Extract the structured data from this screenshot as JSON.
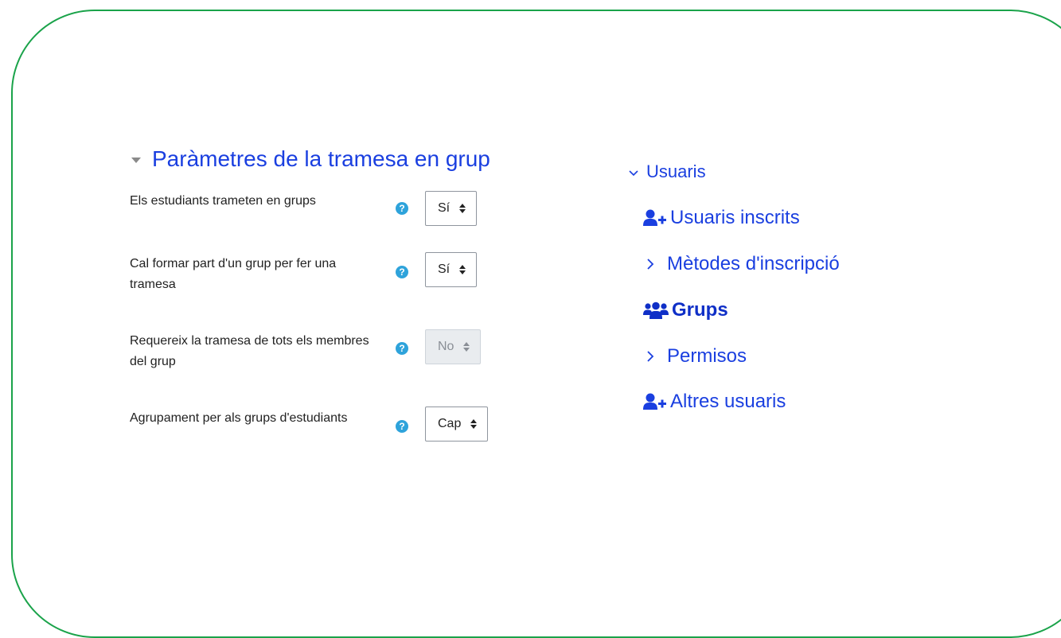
{
  "form": {
    "section_title": "Paràmetres de la tramesa en grup",
    "rows": [
      {
        "label": "Els estudiants trameten en grups",
        "value": "Sí",
        "disabled": false
      },
      {
        "label": "Cal formar part d'un grup per fer una tramesa",
        "value": "Sí",
        "disabled": false
      },
      {
        "label": "Requereix la tramesa de tots els membres del grup",
        "value": "No",
        "disabled": true
      },
      {
        "label": "Agrupament per als grups d'estudiants",
        "value": "Cap",
        "disabled": false
      }
    ],
    "help_glyph": "?"
  },
  "nav": {
    "root": "Usuaris",
    "items": [
      {
        "label": "Usuaris inscrits",
        "icon": "user-plus-icon"
      },
      {
        "label": "Mètodes d'inscripció",
        "icon": "chevron-right-icon"
      },
      {
        "label": "Grups",
        "icon": "users-icon",
        "active": true
      },
      {
        "label": "Permisos",
        "icon": "chevron-right-icon"
      },
      {
        "label": "Altres usuaris",
        "icon": "user-plus-icon"
      }
    ]
  },
  "colors": {
    "frame": "#1aa34a",
    "link": "#1a3fe0",
    "help": "#2ea3db"
  }
}
